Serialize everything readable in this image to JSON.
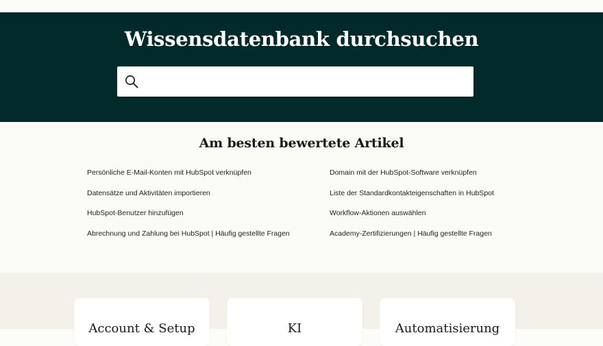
{
  "hero": {
    "title": "Wissensdatenbank durchsuchen",
    "search": {
      "value": "",
      "placeholder": ""
    }
  },
  "top_articles": {
    "title": "Am besten bewertete Artikel",
    "left": [
      "Persönliche E-Mail-Konten mit HubSpot verknüpfen",
      "Datensätze und Aktivitäten importieren",
      "HubSpot-Benutzer hinzufügen",
      "Abrechnung und Zahlung bei HubSpot | Häufig gestellte Fragen"
    ],
    "right": [
      "Domain mit der HubSpot-Software verknüpfen",
      "Liste der Standardkontakteigenschaften in HubSpot",
      "Workflow-Aktionen auswählen",
      "Academy-Zertifizierungen | Häufig gestellte Fragen"
    ]
  },
  "categories": [
    {
      "title": "Account & Setup"
    },
    {
      "title": "KI"
    },
    {
      "title": "Automatisierung"
    }
  ],
  "colors": {
    "hero_bg": "#032a2a",
    "page_bg": "#fcfcf8",
    "category_bg": "#f4f1ea"
  },
  "icons": {
    "search": "search-icon"
  }
}
